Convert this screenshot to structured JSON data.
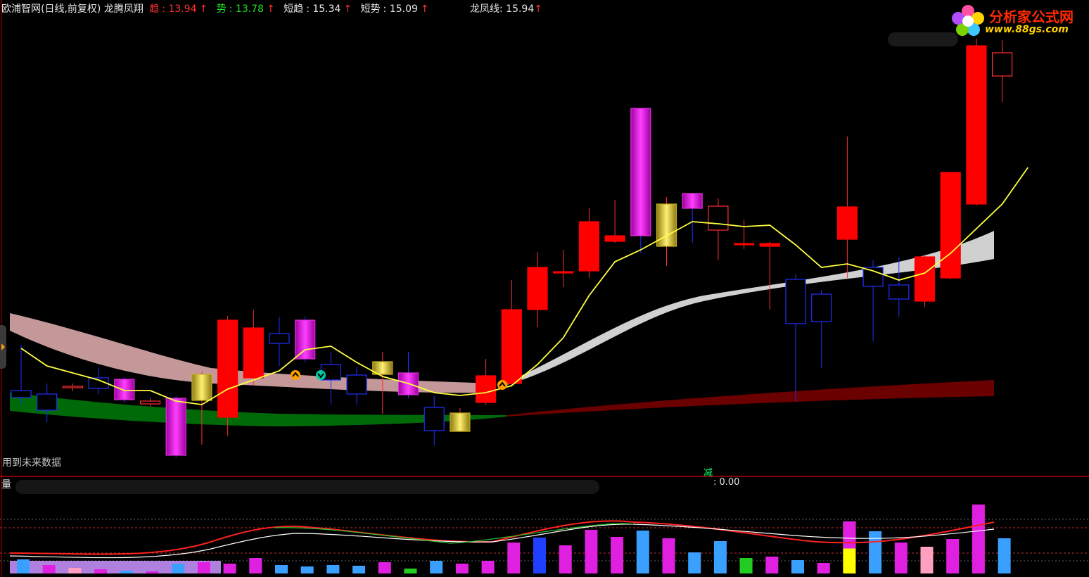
{
  "header": {
    "title": "欧浦智网(日线,前复权) 龙腾凤翔",
    "items": [
      {
        "label": "趋",
        "value": "13.94",
        "color": "#ff3030"
      },
      {
        "label": "势",
        "value": "13.78",
        "color": "#22dd22"
      },
      {
        "label": "短趋",
        "value": "15.34",
        "color": "#e6e6e6"
      },
      {
        "label": "短势",
        "value": "15.09",
        "color": "#e6e6e6"
      }
    ],
    "dragon_line": {
      "label": "龙凤线",
      "value": "15.94"
    }
  },
  "logo": {
    "title": "分析家公式网",
    "url": "www.88gs.com"
  },
  "warning_text": "用到未来数据",
  "volume_panel": {
    "title": "量",
    "value": ": 0.00",
    "marker": "减"
  },
  "chart_data": {
    "type": "candlestick",
    "candles": [
      {
        "o": 555,
        "c": 565,
        "h": 490,
        "l": 575,
        "col": "blue"
      },
      {
        "o": 560,
        "c": 583,
        "h": 545,
        "l": 600,
        "col": "blue"
      },
      {
        "o": 549,
        "c": 551,
        "h": 545,
        "l": 556,
        "col": "wht"
      },
      {
        "o": 537,
        "c": 552,
        "h": 522,
        "l": 560,
        "col": "blue"
      },
      {
        "o": 539,
        "c": 568,
        "h": 536,
        "l": 572,
        "col": "mag"
      },
      {
        "o": 570,
        "c": 574,
        "h": 566,
        "l": 578,
        "col": "wht"
      },
      {
        "o": 566,
        "c": 647,
        "h": 563,
        "l": 650,
        "col": "mag"
      },
      {
        "o": 532,
        "c": 569,
        "h": 528,
        "l": 632,
        "col": "gold"
      },
      {
        "o": 593,
        "c": 455,
        "h": 449,
        "l": 620,
        "col": "red"
      },
      {
        "o": 537,
        "c": 466,
        "h": 440,
        "l": 548,
        "col": "red"
      },
      {
        "o": 474,
        "c": 488,
        "h": 450,
        "l": 520,
        "col": "blue"
      },
      {
        "o": 455,
        "c": 510,
        "h": 450,
        "l": 515,
        "col": "mag"
      },
      {
        "o": 518,
        "c": 540,
        "h": 500,
        "l": 575,
        "col": "blue"
      },
      {
        "o": 533,
        "c": 560,
        "h": 522,
        "l": 575,
        "col": "blue"
      },
      {
        "o": 532,
        "c": 514,
        "h": 500,
        "l": 588,
        "col": "gold"
      },
      {
        "o": 530,
        "c": 561,
        "h": 500,
        "l": 566,
        "col": "mag"
      },
      {
        "o": 579,
        "c": 612,
        "h": 563,
        "l": 633,
        "col": "blue"
      },
      {
        "o": 587,
        "c": 613,
        "h": 580,
        "l": 612,
        "col": "gold"
      },
      {
        "o": 572,
        "c": 534,
        "h": 510,
        "l": 575,
        "col": "red"
      },
      {
        "o": 545,
        "c": 440,
        "h": 398,
        "l": 550,
        "col": "red"
      },
      {
        "o": 440,
        "c": 380,
        "h": 358,
        "l": 465,
        "col": "red"
      },
      {
        "o": 386,
        "c": 388,
        "h": 355,
        "l": 408,
        "col": "red"
      },
      {
        "o": 385,
        "c": 315,
        "h": 296,
        "l": 395,
        "col": "red"
      },
      {
        "o": 343,
        "c": 335,
        "h": 284,
        "l": 345,
        "col": "red"
      },
      {
        "o": 335,
        "c": 154,
        "h": 154,
        "l": 360,
        "col": "mag"
      },
      {
        "o": 290,
        "c": 350,
        "h": 280,
        "l": 378,
        "col": "gold"
      },
      {
        "o": 275,
        "c": 296,
        "h": 274,
        "l": 345,
        "col": "mag"
      },
      {
        "o": 293,
        "c": 327,
        "h": 282,
        "l": 370,
        "col": "wht"
      },
      {
        "o": 346,
        "c": 347,
        "h": 312,
        "l": 354,
        "col": "red"
      },
      {
        "o": 350,
        "c": 346,
        "h": 344,
        "l": 440,
        "col": "red"
      },
      {
        "o": 397,
        "c": 460,
        "h": 390,
        "l": 570,
        "col": "blue"
      },
      {
        "o": 418,
        "c": 457,
        "h": 412,
        "l": 523,
        "col": "blue"
      },
      {
        "o": 340,
        "c": 294,
        "h": 194,
        "l": 395,
        "col": "red"
      },
      {
        "o": 380,
        "c": 407,
        "h": 370,
        "l": 485,
        "col": "blue"
      },
      {
        "o": 405,
        "c": 425,
        "h": 365,
        "l": 450,
        "col": "blue"
      },
      {
        "o": 428,
        "c": 365,
        "h": 362,
        "l": 436,
        "col": "red"
      },
      {
        "o": 395,
        "c": 245,
        "h": 245,
        "l": 397,
        "col": "red"
      },
      {
        "o": 290,
        "c": 65,
        "h": 55,
        "l": 292,
        "col": "red"
      },
      {
        "o": 108,
        "c": 75,
        "h": 57,
        "l": 145,
        "col": "wht"
      }
    ],
    "volume": [
      {
        "v": 20,
        "c": "#3aa0ff"
      },
      {
        "v": 12,
        "c": "#e020e0"
      },
      {
        "v": 8,
        "c": "#ffa0c0"
      },
      {
        "v": 6,
        "c": "#e020e0"
      },
      {
        "v": 4,
        "c": "#3aa0ff"
      },
      {
        "v": 3,
        "c": "#e020e0"
      },
      {
        "v": 14,
        "c": "#3aa0ff"
      },
      {
        "v": 16,
        "c": "#e020e0"
      },
      {
        "v": 14,
        "c": "#e020e0"
      },
      {
        "v": 22,
        "c": "#e020e0"
      },
      {
        "v": 12,
        "c": "#3aa0ff"
      },
      {
        "v": 10,
        "c": "#3aa0ff"
      },
      {
        "v": 12,
        "c": "#3aa0ff"
      },
      {
        "v": 11,
        "c": "#3aa0ff"
      },
      {
        "v": 16,
        "c": "#e020e0"
      },
      {
        "v": 7,
        "c": "#22cc22"
      },
      {
        "v": 18,
        "c": "#3aa0ff"
      },
      {
        "v": 14,
        "c": "#e020e0"
      },
      {
        "v": 18,
        "c": "#e020e0"
      },
      {
        "v": 44,
        "c": "#e020e0"
      },
      {
        "v": 51,
        "c": "#2040ff"
      },
      {
        "v": 40,
        "c": "#e020e0"
      },
      {
        "v": 62,
        "c": "#e020e0"
      },
      {
        "v": 52,
        "c": "#e020e0"
      },
      {
        "v": 61,
        "c": "#3aa0ff"
      },
      {
        "v": 50,
        "c": "#e020e0"
      },
      {
        "v": 30,
        "c": "#3aa0ff"
      },
      {
        "v": 46,
        "c": "#3aa0ff"
      },
      {
        "v": 22,
        "c": "#22cc22"
      },
      {
        "v": 24,
        "c": "#e020e0"
      },
      {
        "v": 19,
        "c": "#3aa0ff"
      },
      {
        "v": 15,
        "c": "#e020e0"
      },
      {
        "v": 74,
        "c": "#ffff00"
      },
      {
        "v": 60,
        "c": "#3aa0ff"
      },
      {
        "v": 44,
        "c": "#e020e0"
      },
      {
        "v": 38,
        "c": "#ffa0c0"
      },
      {
        "v": 49,
        "c": "#e020e0"
      },
      {
        "v": 98,
        "c": "#e020e0"
      },
      {
        "v": 50,
        "c": "#3aa0ff"
      }
    ],
    "yellow_line": [
      495,
      520,
      530,
      540,
      555,
      555,
      570,
      575,
      553,
      540,
      527,
      497,
      492,
      515,
      535,
      545,
      558,
      562,
      558,
      548,
      518,
      480,
      420,
      372,
      355,
      335,
      315,
      318,
      322,
      320,
      348,
      380,
      375,
      385,
      398,
      388,
      360,
      325,
      290,
      238
    ],
    "trend_colors": {
      "green": "#006a08",
      "red": "#6a0000",
      "pink": "#c49898",
      "grey": "#d0d0d0"
    }
  }
}
